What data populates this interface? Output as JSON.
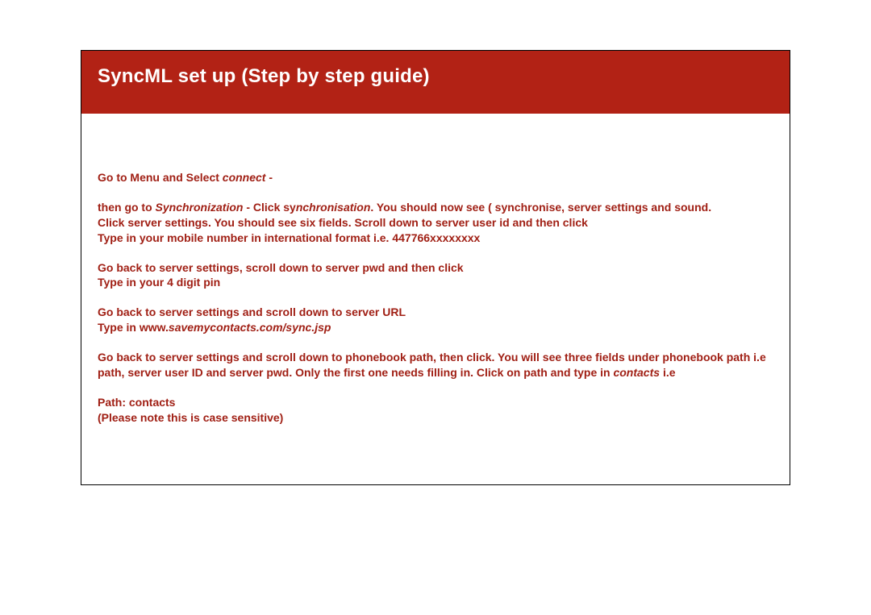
{
  "header": {
    "title": "SyncML set up (Step by step guide)"
  },
  "content": {
    "p1_a": "Go to Menu and Select ",
    "p1_b": "connect",
    "p1_c": "  -",
    "p2_a": "then go to ",
    "p2_b": "Synchronization",
    "p2_c": "  - Click sy",
    "p2_d": "nchronisation",
    "p2_e": ".  You should now see ( synchronise, server settings and sound.",
    "p2_line2": "Click  server settings.  You should see six fields. Scroll down to server user id and then click",
    "p2_line3": "Type in your mobile number in international format  i.e. 447766xxxxxxxx",
    "p3_line1": "Go back to server settings, scroll down to server pwd and then click",
    "p3_line2": "Type in your 4 digit pin",
    "p4_line1": "Go back to server settings and scroll down to server URL",
    "p4_line2a": "Type in  www.",
    "p4_line2b": "savemycontacts.com/sync.jsp",
    "p5_line1a": "Go back to server settings and scroll down to phonebook path, then click. You will see three fields under phonebook path i.e path, server user ID and server pwd. Only the first  one needs filling in. Click on path and type in ",
    "p5_line1b": "contacts ",
    "p5_line1c": "i.e",
    "p6_line1": "Path: contacts",
    "p6_line2": "(Please note this is case sensitive)"
  }
}
